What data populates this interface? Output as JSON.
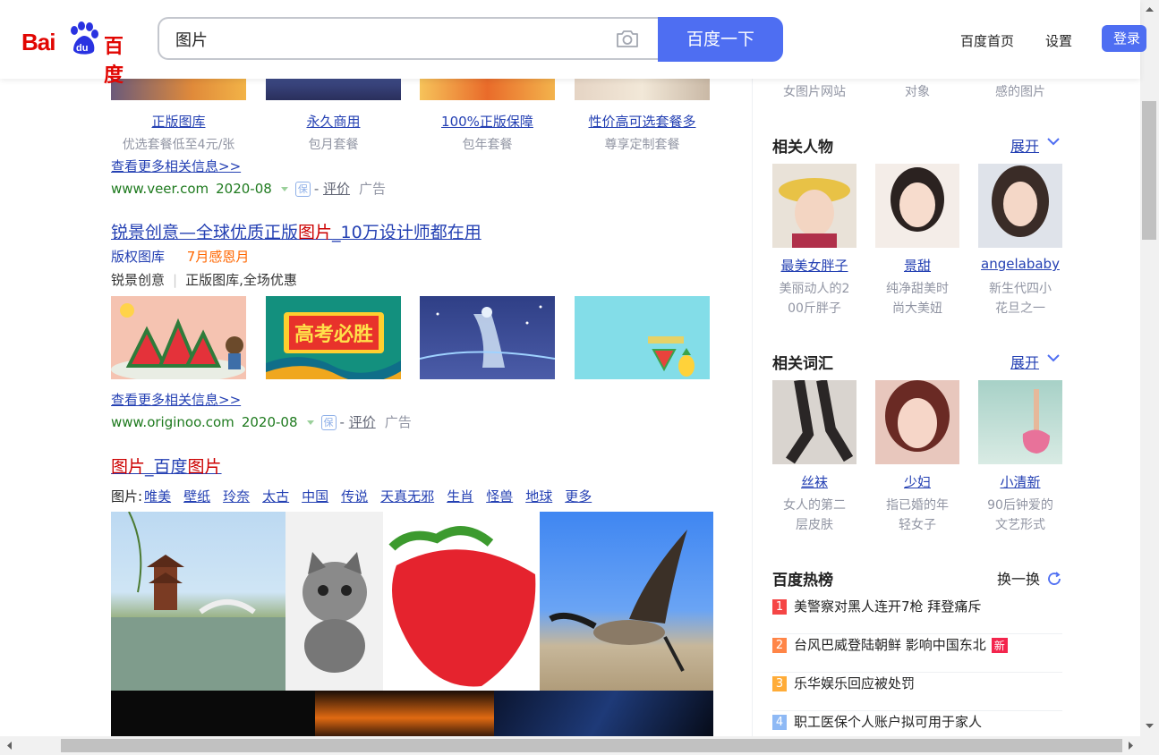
{
  "header": {
    "logo_text_en": "Bai",
    "logo_text_du": "du",
    "logo_text_cn": "百度",
    "search_value": "图片",
    "search_button": "百度一下",
    "nav_home": "百度首页",
    "nav_settings": "设置",
    "login": "登录"
  },
  "results": {
    "veer": {
      "cards": [
        {
          "caption": "正版图库",
          "sub": "优选套餐低至4元/张"
        },
        {
          "caption": "永久商用",
          "sub": "包月套餐"
        },
        {
          "caption": "100%正版保障",
          "sub": "包年套餐"
        },
        {
          "caption": "性价高可选套餐多",
          "sub": "尊享定制套餐"
        }
      ],
      "more": "查看更多相关信息>>",
      "domain": "www.veer.com",
      "date": "2020-08",
      "bao": "保",
      "rate": "评价",
      "ad": "广告"
    },
    "originoo": {
      "title_a": "锐景创意—全球优质正版",
      "title_em": "图片",
      "title_b": "_10万设计师都在用",
      "tag1": "版权图库",
      "tag2": "7月感恩月",
      "desc_a": "锐景创意",
      "desc_b": "正版图库,全场优惠",
      "banner_text": "高考必胜",
      "more": "查看更多相关信息>>",
      "domain": "www.originoo.com",
      "date": "2020-08",
      "bao": "保",
      "rate": "评价",
      "ad": "广告"
    },
    "baidu_image": {
      "title_em1": "图片",
      "title_mid": "_百度",
      "title_em2": "图片",
      "tags_label": "图片:",
      "tags": [
        "唯美",
        "壁纸",
        "玲奈",
        "太古",
        "中国",
        "传说",
        "天真无邪",
        "生肖",
        "怪兽",
        "地球",
        "更多"
      ]
    }
  },
  "sidebar": {
    "top_captions": [
      "女图片网站",
      "对象",
      "感的图片"
    ],
    "people_title": "相关人物",
    "people_expand": "展开",
    "people": [
      {
        "name": "最美女胖子",
        "desc1": "美丽动人的2",
        "desc2": "00斤胖子"
      },
      {
        "name": "景甜",
        "desc1": "纯净甜美时",
        "desc2": "尚大美妞"
      },
      {
        "name": "angelababy",
        "desc1": "新生代四小",
        "desc2": "花旦之一"
      }
    ],
    "words_title": "相关词汇",
    "words_expand": "展开",
    "words": [
      {
        "name": "丝袜",
        "desc1": "女人的第二",
        "desc2": "层皮肤"
      },
      {
        "name": "少妇",
        "desc1": "指已婚的年",
        "desc2": "轻女子"
      },
      {
        "name": "小清新",
        "desc1": "90后钟爱的",
        "desc2": "文艺形式"
      }
    ],
    "hot_title": "百度热榜",
    "hot_refresh": "换一换",
    "hot": [
      {
        "rank": "1",
        "text": "美警察对黑人连开7枪 拜登痛斥",
        "color": "#f54545"
      },
      {
        "rank": "2",
        "text": "台风巴威登陆朝鲜 影响中国东北",
        "color": "#ff8547",
        "badge": "新"
      },
      {
        "rank": "3",
        "text": "乐华娱乐回应被处罚",
        "color": "#ffac38"
      },
      {
        "rank": "4",
        "text": "职工医保个人账户拟可用于家人",
        "color": "#8eb9f5"
      }
    ]
  }
}
